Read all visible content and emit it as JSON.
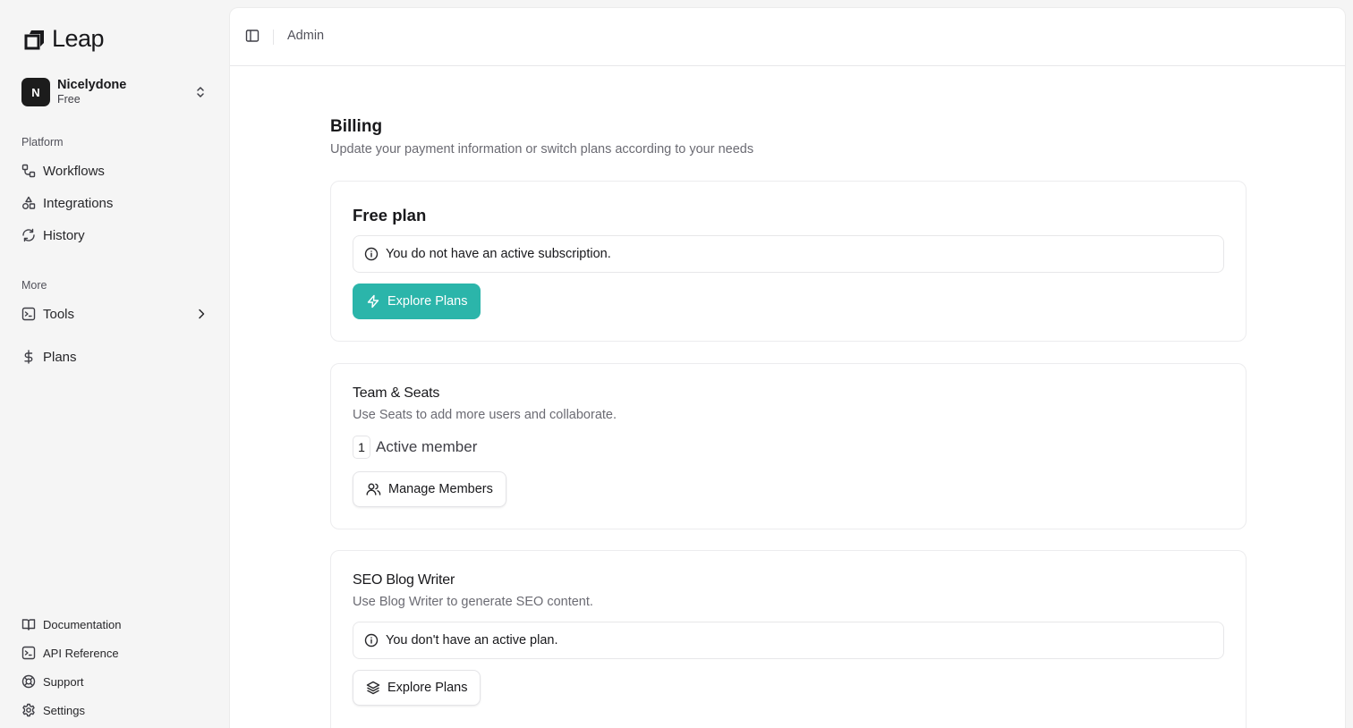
{
  "brand": {
    "name": "Leap"
  },
  "org": {
    "initial": "N",
    "name": "Nicelydone",
    "plan": "Free"
  },
  "sidebar": {
    "platform_label": "Platform",
    "platform_items": [
      {
        "label": "Workflows",
        "icon": "workflow-icon"
      },
      {
        "label": "Integrations",
        "icon": "shapes-icon"
      },
      {
        "label": "History",
        "icon": "refresh-icon"
      }
    ],
    "more_label": "More",
    "more_items": [
      {
        "label": "Tools",
        "icon": "terminal-icon"
      },
      {
        "label": "Plans",
        "icon": "dollar-icon"
      }
    ],
    "footer_items": [
      {
        "label": "Documentation",
        "icon": "book-icon"
      },
      {
        "label": "API Reference",
        "icon": "terminal-icon"
      },
      {
        "label": "Support",
        "icon": "lifebuoy-icon"
      },
      {
        "label": "Settings",
        "icon": "gear-icon"
      }
    ]
  },
  "header": {
    "breadcrumb": "Admin"
  },
  "page": {
    "title": "Billing",
    "subtitle": "Update your payment information or switch plans according to your needs"
  },
  "free_plan": {
    "title": "Free plan",
    "alert": "You do not have an active subscription.",
    "button": "Explore Plans"
  },
  "team": {
    "title": "Team & Seats",
    "description": "Use Seats to add more users and collaborate.",
    "count": "1",
    "count_label": "Active member",
    "button": "Manage Members"
  },
  "seo": {
    "title": "SEO Blog Writer",
    "description": "Use Blog Writer to generate SEO content.",
    "alert": "You don't have an active plan.",
    "button": "Explore Plans"
  },
  "colors": {
    "accent": "#2bb5aa",
    "sidebar_bg": "#f5f5f5"
  }
}
